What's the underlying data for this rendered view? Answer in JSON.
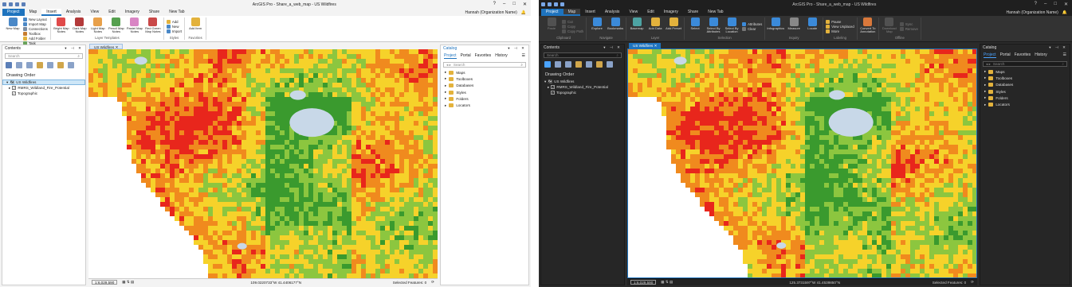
{
  "app_title": "ArcGIS Pro - Share_a_web_map - US Wildfires",
  "window_controls": [
    "?",
    "–",
    "□",
    "✕"
  ],
  "tabs": [
    "Project",
    "Map",
    "Insert",
    "Analysis",
    "View",
    "Edit",
    "Imagery",
    "Share",
    "New Tab"
  ],
  "user": "Hannah (Organization Name)",
  "light": {
    "active_tab": "Insert",
    "groups": [
      {
        "label": "Project",
        "large": [
          {
            "label": "New Map",
            "color": "#4a88c7"
          }
        ],
        "small": [
          {
            "label": "New Layout",
            "color": "#4a88c7"
          },
          {
            "label": "Import Map",
            "color": "#4a88c7"
          },
          {
            "label": "Connections",
            "color": "#7b8da3"
          },
          {
            "label": "Toolbox",
            "color": "#c77d2f"
          },
          {
            "label": "Add Folder",
            "color": "#e3b23c"
          },
          {
            "label": "Task",
            "color": "#6aa35a"
          }
        ]
      },
      {
        "label": "Layer Templates",
        "large": [
          {
            "label": "Bright Map Notes",
            "color": "#e04a4a"
          },
          {
            "label": "Dark Map Notes",
            "color": "#b33a3a"
          },
          {
            "label": "Light Map Notes",
            "color": "#e8a04a"
          },
          {
            "label": "Pencil Map Notes",
            "color": "#55a04f"
          },
          {
            "label": "Pastel Map Notes",
            "color": "#d985c4"
          },
          {
            "label": "Red Green Map Notes",
            "color": "#c94848"
          }
        ],
        "small": []
      },
      {
        "label": "Styles",
        "large": [],
        "small": [
          {
            "label": "Add",
            "color": "#e3b23c"
          },
          {
            "label": "New",
            "color": "#4a88c7"
          },
          {
            "label": "Import",
            "color": "#4a88c7"
          }
        ]
      },
      {
        "label": "Favorites",
        "large": [
          {
            "label": "Add Item",
            "color": "#e3b23c"
          }
        ],
        "small": []
      }
    ]
  },
  "dark": {
    "active_tab": "Map",
    "groups": [
      {
        "label": "Clipboard",
        "dim": true,
        "large": [
          {
            "label": "Paste",
            "color": "#777777"
          }
        ],
        "small": [
          {
            "label": "Cut",
            "color": "#777777"
          },
          {
            "label": "Copy",
            "color": "#777777"
          },
          {
            "label": "Copy Path",
            "color": "#777777"
          }
        ]
      },
      {
        "label": "Navigate",
        "large": [
          {
            "label": "Explore",
            "color": "#3b8ad9"
          },
          {
            "label": "Bookmarks",
            "color": "#3b8ad9"
          }
        ],
        "small": []
      },
      {
        "label": "Layer",
        "large": [
          {
            "label": "Basemap",
            "color": "#4da3a3"
          },
          {
            "label": "Add Data",
            "color": "#e3b23c"
          },
          {
            "label": "Add Preset",
            "color": "#e3b23c"
          }
        ],
        "small": []
      },
      {
        "label": "Selection",
        "large": [
          {
            "label": "Select",
            "color": "#3b8ad9"
          },
          {
            "label": "Select By Attributes",
            "color": "#3b8ad9"
          },
          {
            "label": "Select By Location",
            "color": "#3b8ad9"
          }
        ],
        "small": [
          {
            "label": "Attributes",
            "color": "#3b8ad9"
          },
          {
            "label": "Clear",
            "color": "#777777"
          }
        ]
      },
      {
        "label": "Inquiry",
        "large": [
          {
            "label": "Infographics",
            "color": "#3b8ad9"
          },
          {
            "label": "Measure",
            "color": "#888888"
          },
          {
            "label": "Locate",
            "color": "#3b8ad9"
          }
        ],
        "small": []
      },
      {
        "label": "Labeling",
        "large": [],
        "small": [
          {
            "label": "Pause",
            "color": "#e3b23c"
          },
          {
            "label": "View Unplaced",
            "color": "#e3b23c"
          },
          {
            "label": "More",
            "color": "#e3b23c"
          }
        ]
      },
      {
        "label": "",
        "large": [
          {
            "label": "Convert To Annotation",
            "color": "#d9783b"
          }
        ],
        "small": []
      },
      {
        "label": "Offline",
        "dim": true,
        "large": [
          {
            "label": "Download Map",
            "color": "#777777"
          }
        ],
        "small": [
          {
            "label": "Sync",
            "color": "#777777"
          },
          {
            "label": "Remove",
            "color": "#777777"
          }
        ]
      }
    ]
  },
  "contents": {
    "title": "Contents",
    "search_placeholder": "Search",
    "drawing_order": "Drawing Order",
    "map_name": "US Wildfires",
    "layers": [
      "RMRS_Wildland_Fire_Potential",
      "Topographic"
    ]
  },
  "catalog": {
    "title": "Catalog",
    "tabs": [
      "Project",
      "Portal",
      "Favorites",
      "History"
    ],
    "search_placeholder": "Search",
    "items": [
      "Maps",
      "Toolboxes",
      "Databases",
      "Styles",
      "Folders",
      "Locators"
    ]
  },
  "map_tab": "US Wildfires",
  "status": {
    "scale": "1:6,029,590",
    "light_coords": "109.0220733°W 41.4406177°N",
    "dark_coords": "125.3731597°W 41.4539850°N",
    "selected_features": "Selected Features: 0"
  },
  "colors": {
    "accent": "#1e73be",
    "fire_high": "#e8261c",
    "fire_mod": "#f08a1e",
    "fire_low": "#f6d22a",
    "fire_vlow": "#8cc63f",
    "non_burn": "#3a9a2e",
    "water": "#3b7bd6"
  }
}
